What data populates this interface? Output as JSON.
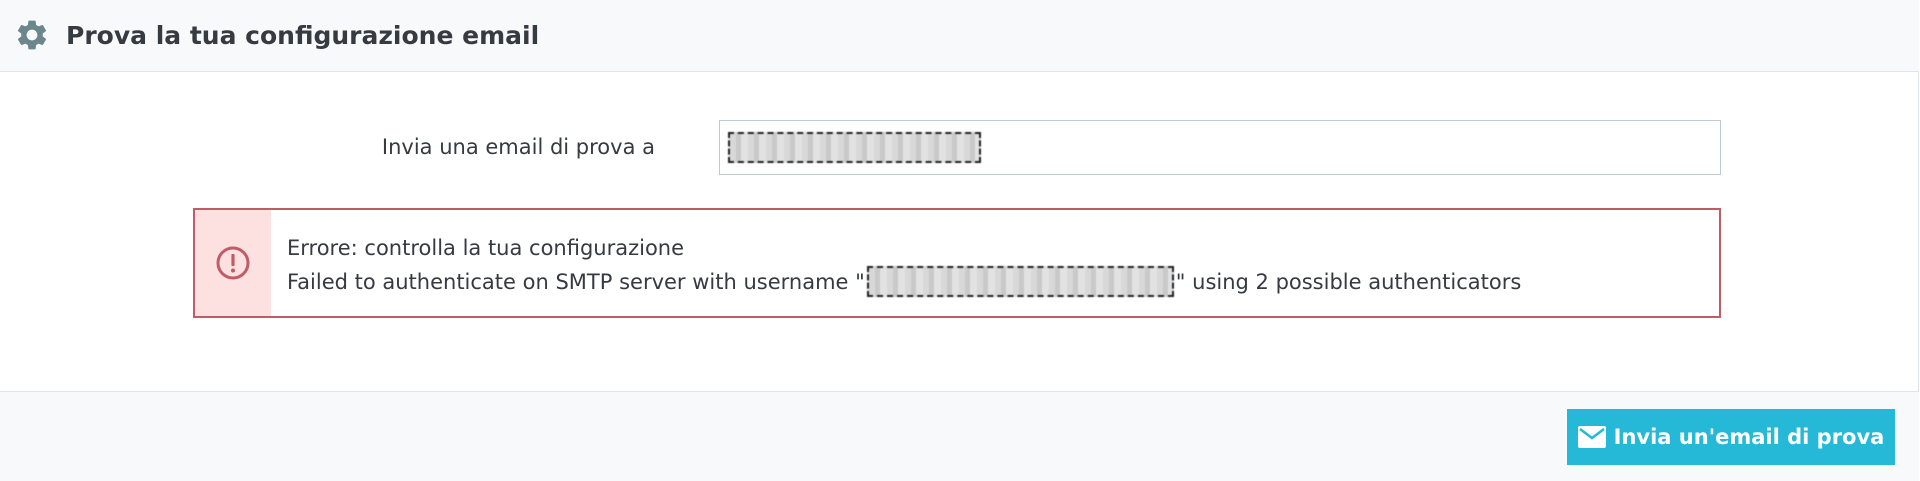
{
  "panel": {
    "title": "Prova la tua configurazione email",
    "icon": "gear-icon"
  },
  "form": {
    "email_label": "Invia una email di prova a",
    "email_value": "[redacted]"
  },
  "alert": {
    "title": "Errore: controlla la tua configurazione",
    "message_prefix": "Failed to authenticate on SMTP server with username \"",
    "username": "[redacted]",
    "message_suffix": "\" using 2 possible authenticators",
    "icon": "error-circle-icon",
    "color": "#c05c67"
  },
  "footer": {
    "send_label": "Invia un'email di prova",
    "send_icon": "mail-icon",
    "button_color": "#25b9d7"
  }
}
